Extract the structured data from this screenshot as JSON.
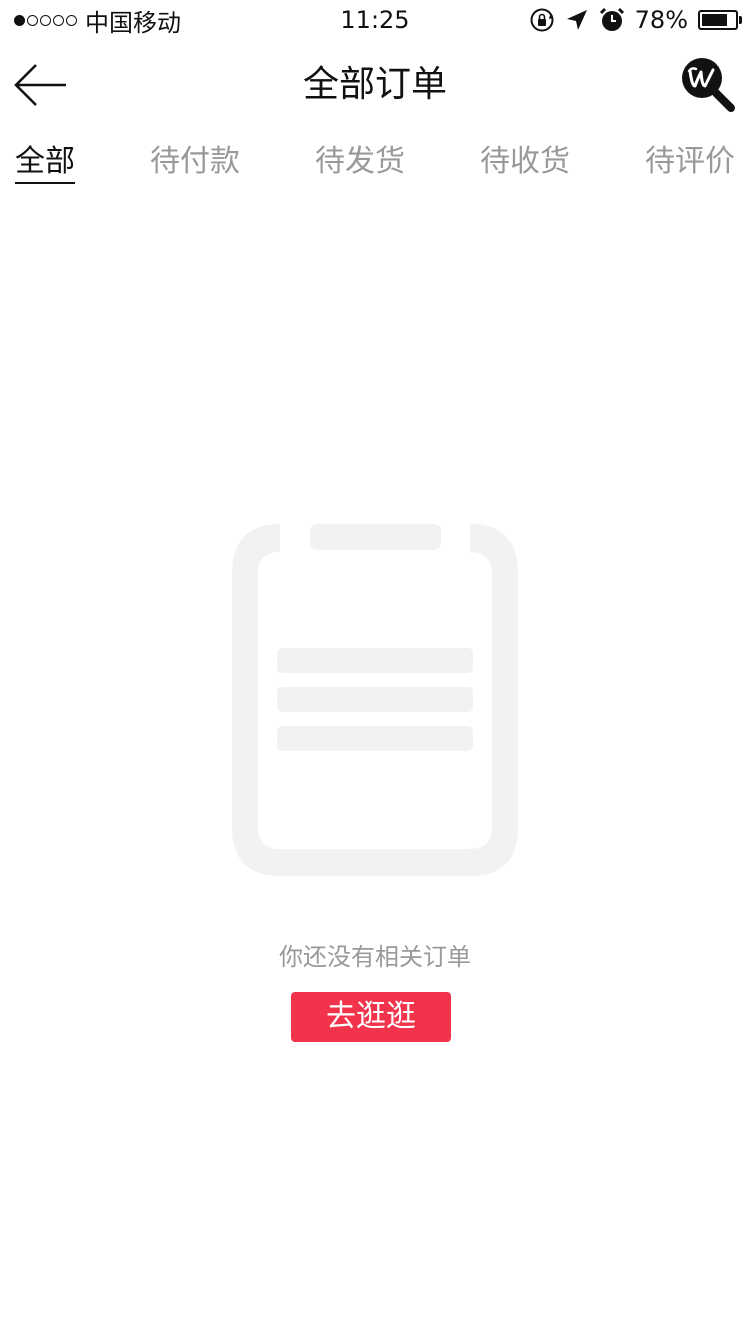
{
  "status_bar": {
    "signal_dots_filled": 1,
    "signal_dots_total": 5,
    "carrier": "中国移动",
    "time": "11:25",
    "battery_percent": "78%",
    "battery_level": 0.78
  },
  "nav": {
    "title": "全部订单",
    "back_icon": "arrow-left-icon",
    "search_icon": "w-magnifier-logo-icon"
  },
  "tabs": [
    {
      "label": "全部",
      "active": true
    },
    {
      "label": "待付款",
      "active": false
    },
    {
      "label": "待发货",
      "active": false
    },
    {
      "label": "待收货",
      "active": false
    },
    {
      "label": "待评价",
      "active": false
    }
  ],
  "empty_state": {
    "icon": "clipboard-empty-icon",
    "message": "你还没有相关订单",
    "button_label": "去逛逛"
  },
  "colors": {
    "accent": "#f1334b",
    "muted_text": "#999999",
    "primary_text": "#111111",
    "illustration": "#f2f2f2"
  }
}
